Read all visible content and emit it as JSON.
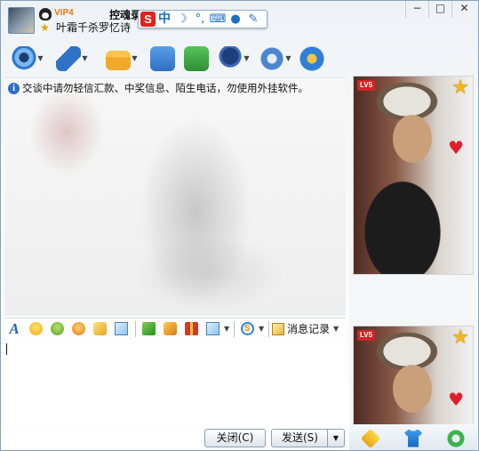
{
  "header": {
    "vip_label": "VIP4",
    "nickname": "控魂录",
    "signature": "叶霜千杀罗忆诗"
  },
  "ime": {
    "logo": "S",
    "lang": "中"
  },
  "window_controls": {
    "minimize": "−",
    "maximize": "□",
    "close": "✕"
  },
  "message_area": {
    "notice": "交谈中请勿轻信汇款、中奖信息、陌生电话，勿使用外挂软件。"
  },
  "format_bar": {
    "font_label": "A",
    "history_label": "消息记录"
  },
  "input": {
    "value": ""
  },
  "buttons": {
    "close_label": "关闭(C)",
    "send_label": "发送(S)",
    "send_menu": "▼"
  },
  "right_panel": {
    "level_badge_top": "LV5",
    "level_badge_bottom": "LV5"
  },
  "icons": [
    "qq-penguin-icon",
    "star-icon",
    "video-icon",
    "mic-icon",
    "folder-icon",
    "mail-icon",
    "add-app-icon",
    "police-icon",
    "apps-icon",
    "browser-icon",
    "info-icon",
    "font-icon",
    "emoji-icon",
    "gift-icon",
    "history-icon",
    "star-badge-icon",
    "heart-icon",
    "diamond-icon",
    "shirt-icon",
    "refresh-icon"
  ],
  "colors": {
    "accent": "#2f6fc3",
    "vip": "#e8780c",
    "level_badge": "#d22424"
  }
}
